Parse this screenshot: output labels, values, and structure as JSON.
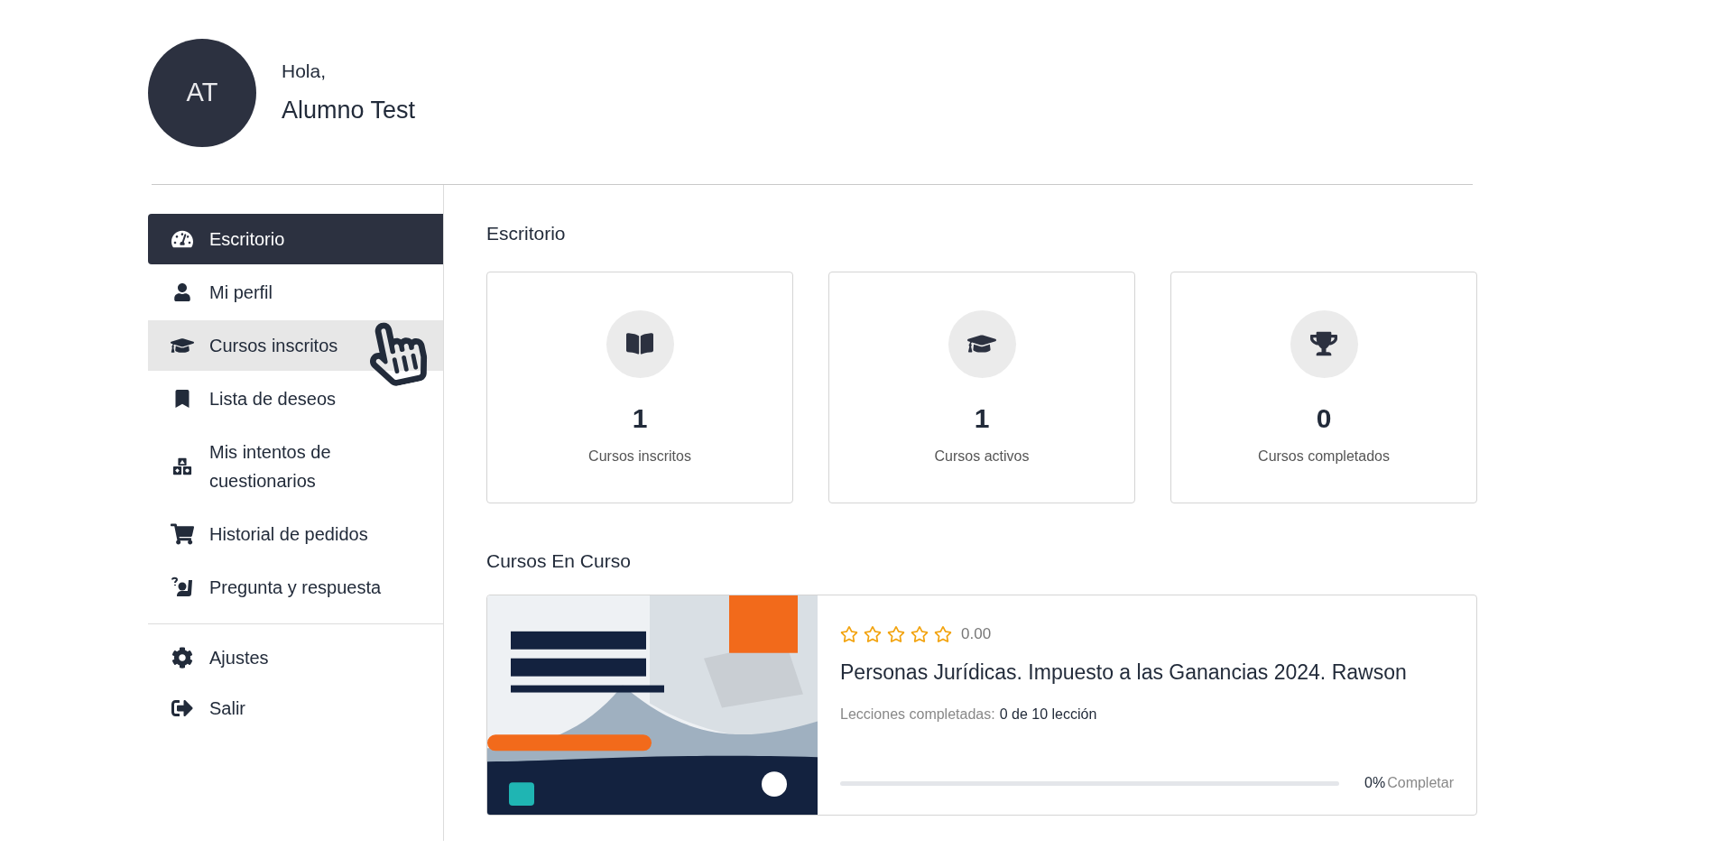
{
  "user": {
    "initials": "AT",
    "greeting": "Hola,",
    "name": "Alumno Test"
  },
  "sidebar": {
    "items": [
      {
        "label": "Escritorio",
        "selected": true,
        "hovered": false
      },
      {
        "label": "Mi perfil",
        "selected": false,
        "hovered": false
      },
      {
        "label": "Cursos inscritos",
        "selected": false,
        "hovered": true
      },
      {
        "label": "Lista de deseos",
        "selected": false,
        "hovered": false
      },
      {
        "label": "Mis intentos de cuestionarios",
        "selected": false,
        "hovered": false
      },
      {
        "label": "Historial de pedidos",
        "selected": false,
        "hovered": false
      },
      {
        "label": "Pregunta y respuesta",
        "selected": false,
        "hovered": false
      }
    ],
    "footer_items": [
      {
        "label": "Ajustes",
        "selected": false
      },
      {
        "label": "Salir",
        "selected": false
      }
    ]
  },
  "dashboard": {
    "title": "Escritorio",
    "stats": [
      {
        "value": "1",
        "label": "Cursos inscritos"
      },
      {
        "value": "1",
        "label": "Cursos activos"
      },
      {
        "value": "0",
        "label": "Cursos completados"
      }
    ]
  },
  "in_progress": {
    "title": "Cursos En Curso",
    "courses": [
      {
        "stars": 0,
        "rating": "0.00",
        "title": "Personas Jurídicas. Impuesto a las Ganancias 2024. Rawson",
        "lessons_label": "Lecciones completadas:",
        "lessons_value": "0 de 10 lección",
        "level": 0,
        "percent": "0%",
        "complete_label": "Completar"
      }
    ]
  }
}
